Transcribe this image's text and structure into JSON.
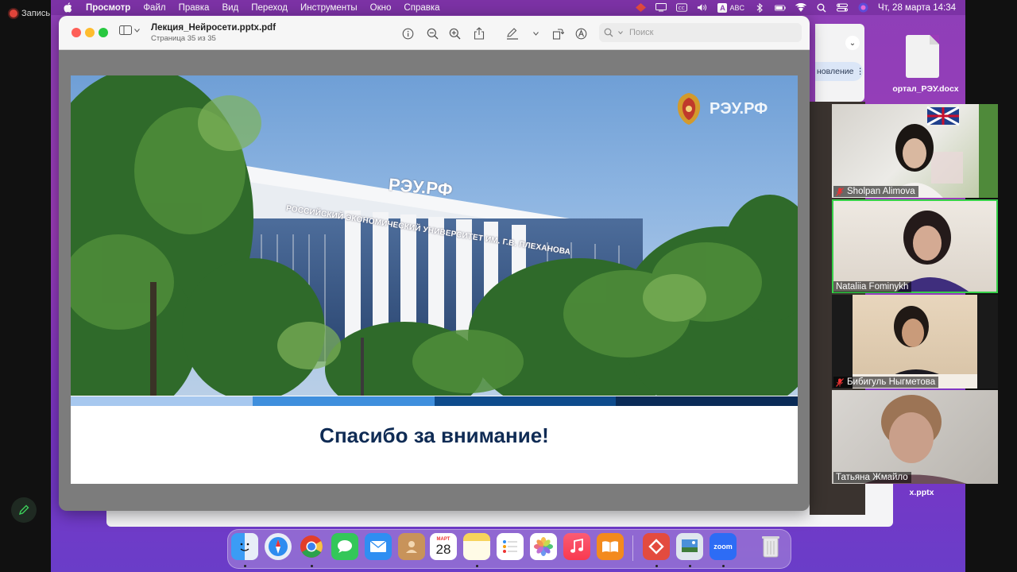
{
  "recording": {
    "label": "Запись"
  },
  "menubar": {
    "app": "Просмотр",
    "items": [
      "Файл",
      "Правка",
      "Вид",
      "Переход",
      "Инструменты",
      "Окно",
      "Справка"
    ],
    "input_source": "ABC",
    "datetime": "Чт, 28 марта  14:34"
  },
  "background": {
    "pill_text": "новление",
    "file1": "ортал_РЭУ.docx",
    "file2": "x.pptx"
  },
  "preview": {
    "doc_title": "Лекция_Нейросети.pptx.pdf",
    "page_info": "Страница 35 из 35",
    "search_placeholder": "Поиск",
    "slide": {
      "logo_text": "РЭУ.РФ",
      "building_sign": "РЭУ.РФ",
      "building_text": "РОССИЙСКИЙ ЭКОНОМИЧЕСКИЙ УНИВЕРСИТЕТ ИМ. Г.В. ПЛЕХАНОВА",
      "thanks": "Спасибо за внимание!",
      "stripe_colors": [
        "#a7c8ef",
        "#3f8fdd",
        "#0e4b8c",
        "#0a2b57"
      ]
    }
  },
  "participants": [
    {
      "name": "Sholpan Alimova",
      "muted": true,
      "active": false
    },
    {
      "name": "Nataliia Fominykh",
      "muted": false,
      "active": true
    },
    {
      "name": "Бибигуль Ныгметова",
      "muted": true,
      "active": false
    },
    {
      "name": "Татьяна Жмайло",
      "muted": false,
      "active": false
    }
  ],
  "dock": {
    "calendar_month": "МАРТ",
    "calendar_day": "28",
    "zoom_label": "zoom",
    "apps": [
      "finder-icon",
      "safari-icon",
      "chrome-icon",
      "messages-icon",
      "mail-icon",
      "contacts-icon",
      "calendar-icon",
      "notes-icon",
      "reminders-icon",
      "photos-icon",
      "music-icon",
      "books-icon",
      "anydesk-icon",
      "preview-icon",
      "zoom-icon",
      "trash-icon"
    ]
  }
}
